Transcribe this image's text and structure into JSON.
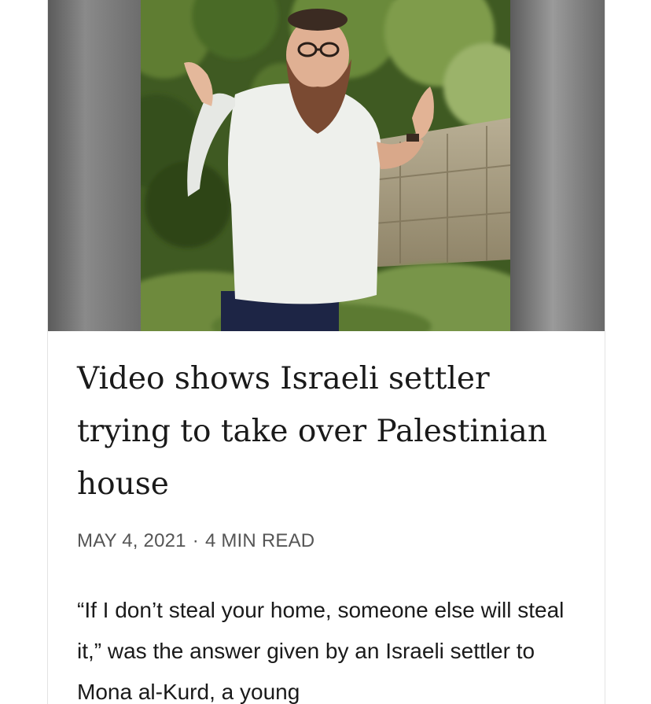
{
  "article": {
    "title": "Video shows Israeli settler trying to take over Palestinian house",
    "date": "MAY 4, 2021",
    "separator": "·",
    "read_time": "4 MIN READ",
    "excerpt": "“If I don’t steal your home, someone else will steal it,” was the answer given by an Israeli settler to Mona al-Kurd, a young"
  },
  "colors": {
    "title": "#1a1a1a",
    "meta": "#555555",
    "body": "#1a1a1a",
    "card_border": "#e3e3e3"
  },
  "icons": {
    "hero_image": "video-still-photo"
  }
}
